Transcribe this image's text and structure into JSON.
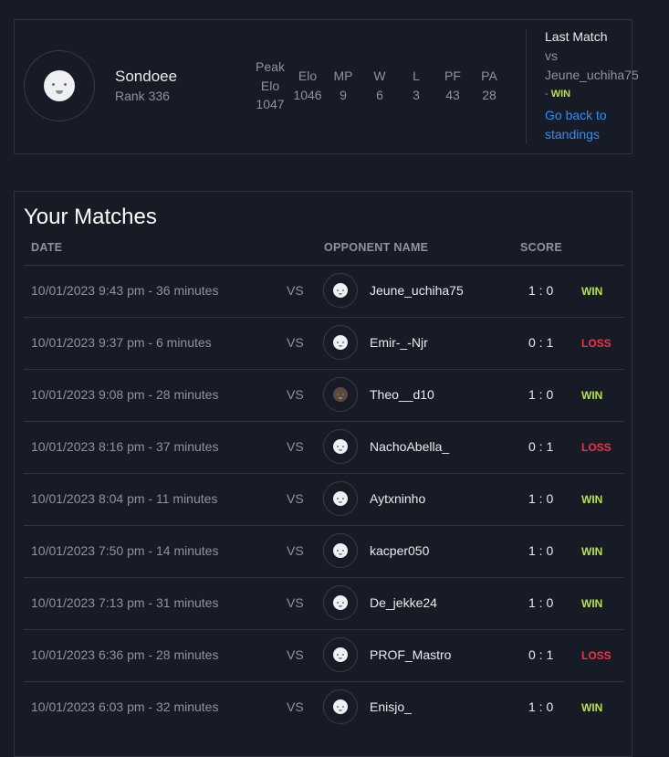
{
  "profile": {
    "name": "Sondoee",
    "rank": "Rank 336",
    "stats": [
      {
        "label": "Peak Elo",
        "value": "1047"
      },
      {
        "label": "Elo",
        "value": "1046"
      },
      {
        "label": "MP",
        "value": "9"
      },
      {
        "label": "W",
        "value": "6"
      },
      {
        "label": "L",
        "value": "3"
      },
      {
        "label": "PF",
        "value": "43"
      },
      {
        "label": "PA",
        "value": "28"
      }
    ],
    "last_match": {
      "title": "Last Match",
      "vs": "vs",
      "opponent": "Jeune_uchiha75",
      "result_prefix": "- ",
      "result": "WIN",
      "back_link": "Go back to standings"
    }
  },
  "matches": {
    "title": "Your Matches",
    "headers": {
      "date": "DATE",
      "opponent": "OPPONENT NAME",
      "score": "SCORE"
    },
    "rows": [
      {
        "date": "10/01/2023 9:43 pm - 36 minutes",
        "vs": "VS",
        "opponent": "Jeune_uchiha75",
        "score": "1 : 0",
        "result": "WIN"
      },
      {
        "date": "10/01/2023 9:37 pm - 6 minutes",
        "vs": "VS",
        "opponent": "Emir-_-Njr",
        "score": "0 : 1",
        "result": "LOSS"
      },
      {
        "date": "10/01/2023 9:08 pm - 28 minutes",
        "vs": "VS",
        "opponent": "Theo__d10",
        "score": "1 : 0",
        "result": "WIN"
      },
      {
        "date": "10/01/2023 8:16 pm - 37 minutes",
        "vs": "VS",
        "opponent": "NachoAbella_",
        "score": "0 : 1",
        "result": "LOSS"
      },
      {
        "date": "10/01/2023 8:04 pm - 11 minutes",
        "vs": "VS",
        "opponent": "Aytxninho",
        "score": "1 : 0",
        "result": "WIN"
      },
      {
        "date": "10/01/2023 7:50 pm - 14 minutes",
        "vs": "VS",
        "opponent": "kacper050",
        "score": "1 : 0",
        "result": "WIN"
      },
      {
        "date": "10/01/2023 7:13 pm - 31 minutes",
        "vs": "VS",
        "opponent": "De_jekke24",
        "score": "1 : 0",
        "result": "WIN"
      },
      {
        "date": "10/01/2023 6:36 pm - 28 minutes",
        "vs": "VS",
        "opponent": "PROF_Mastro",
        "score": "0 : 1",
        "result": "LOSS"
      },
      {
        "date": "10/01/2023 6:03 pm - 32 minutes",
        "vs": "VS",
        "opponent": "Enisjo_",
        "score": "1 : 0",
        "result": "WIN"
      }
    ]
  },
  "colors": {
    "win": "#b8e24a",
    "loss": "#f0314d",
    "link": "#2f8ff7",
    "background": "#161b26"
  }
}
